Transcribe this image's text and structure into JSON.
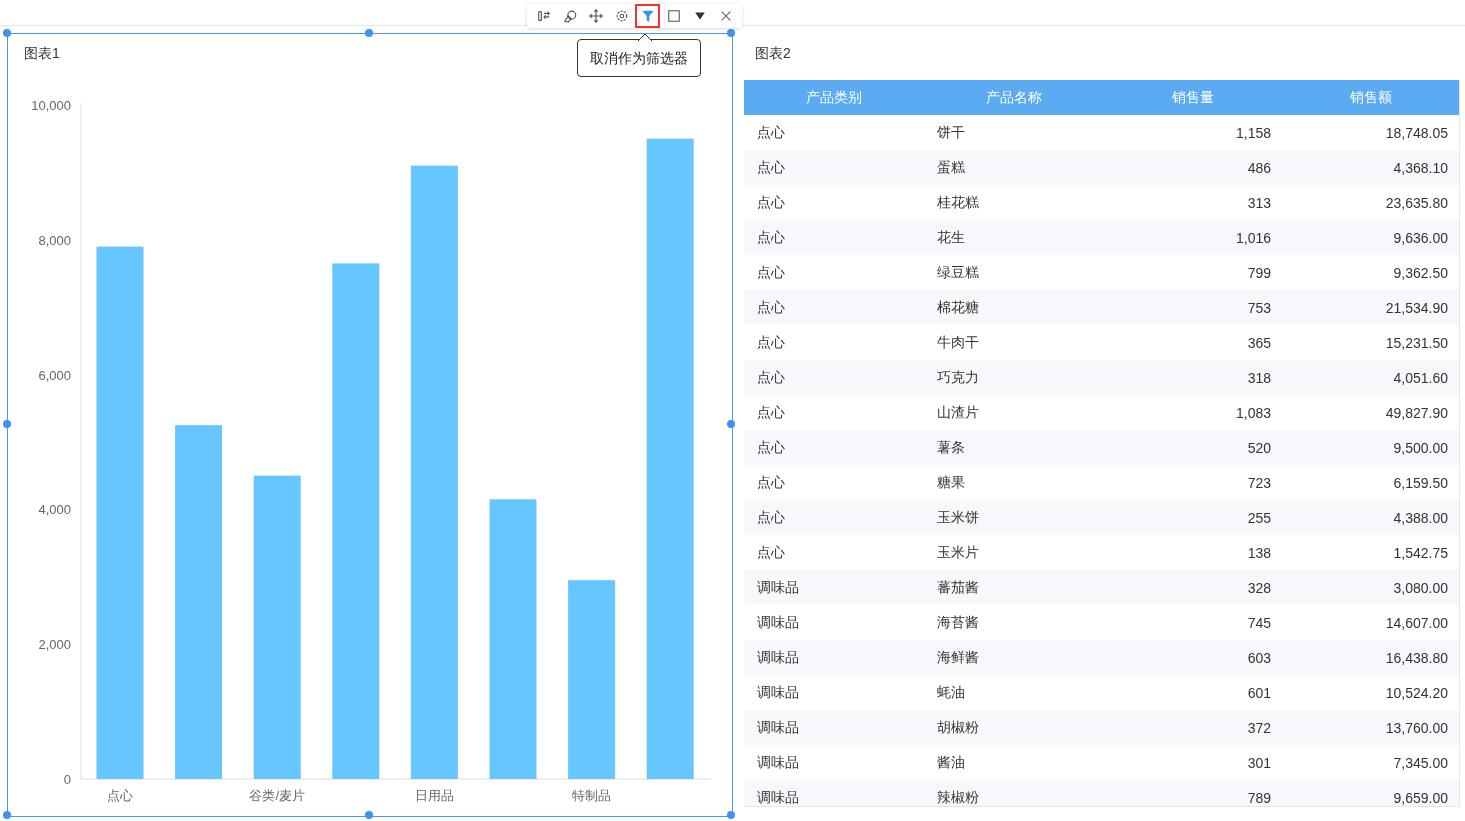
{
  "toolbar": {
    "buttons": [
      {
        "kind": "swap",
        "selected": false
      },
      {
        "kind": "link",
        "selected": false
      },
      {
        "kind": "move",
        "selected": false
      },
      {
        "kind": "settings",
        "selected": false
      },
      {
        "kind": "filter",
        "selected": true
      },
      {
        "kind": "maximize",
        "selected": false
      },
      {
        "kind": "menu",
        "selected": false
      },
      {
        "kind": "close",
        "selected": false
      }
    ],
    "tooltip": "取消作为筛选器"
  },
  "chart_panel": {
    "title": "图表1",
    "selected": true,
    "chart_data": {
      "type": "bar",
      "categories": [
        "点心",
        null,
        "谷类/麦片",
        null,
        "日用品",
        null,
        "特制品",
        null
      ],
      "series": [
        {
          "color": "#66c6ff",
          "values": [
            7900,
            5250,
            4500,
            7650,
            9100,
            4150,
            2950,
            9500
          ]
        }
      ],
      "ylim": [
        0,
        10000
      ],
      "yticks": [
        {
          "value": 0,
          "label": "0"
        },
        {
          "value": 2000,
          "label": "2,000"
        },
        {
          "value": 4000,
          "label": "4,000"
        },
        {
          "value": 6000,
          "label": "6,000"
        },
        {
          "value": 8000,
          "label": "8,000"
        },
        {
          "value": 10000,
          "label": "10,000"
        }
      ]
    }
  },
  "table_panel": {
    "title": "图表2",
    "columns": [
      "产品类别",
      "产品名称",
      "销售量",
      "销售额"
    ],
    "rows": [
      [
        "点心",
        "饼干",
        "1,158",
        "18,748.05"
      ],
      [
        "点心",
        "蛋糕",
        "486",
        "4,368.10"
      ],
      [
        "点心",
        "桂花糕",
        "313",
        "23,635.80"
      ],
      [
        "点心",
        "花生",
        "1,016",
        "9,636.00"
      ],
      [
        "点心",
        "绿豆糕",
        "799",
        "9,362.50"
      ],
      [
        "点心",
        "棉花糖",
        "753",
        "21,534.90"
      ],
      [
        "点心",
        "牛肉干",
        "365",
        "15,231.50"
      ],
      [
        "点心",
        "巧克力",
        "318",
        "4,051.60"
      ],
      [
        "点心",
        "山渣片",
        "1,083",
        "49,827.90"
      ],
      [
        "点心",
        "薯条",
        "520",
        "9,500.00"
      ],
      [
        "点心",
        "糖果",
        "723",
        "6,159.50"
      ],
      [
        "点心",
        "玉米饼",
        "255",
        "4,388.00"
      ],
      [
        "点心",
        "玉米片",
        "138",
        "1,542.75"
      ],
      [
        "调味品",
        "蕃茄酱",
        "328",
        "3,080.00"
      ],
      [
        "调味品",
        "海苔酱",
        "745",
        "14,607.00"
      ],
      [
        "调味品",
        "海鲜酱",
        "603",
        "16,438.80"
      ],
      [
        "调味品",
        "蚝油",
        "601",
        "10,524.20"
      ],
      [
        "调味品",
        "胡椒粉",
        "372",
        "13,760.00"
      ],
      [
        "调味品",
        "酱油",
        "301",
        "7,345.00"
      ],
      [
        "调味品",
        "辣椒粉",
        "789",
        "9,659.00"
      ]
    ]
  }
}
